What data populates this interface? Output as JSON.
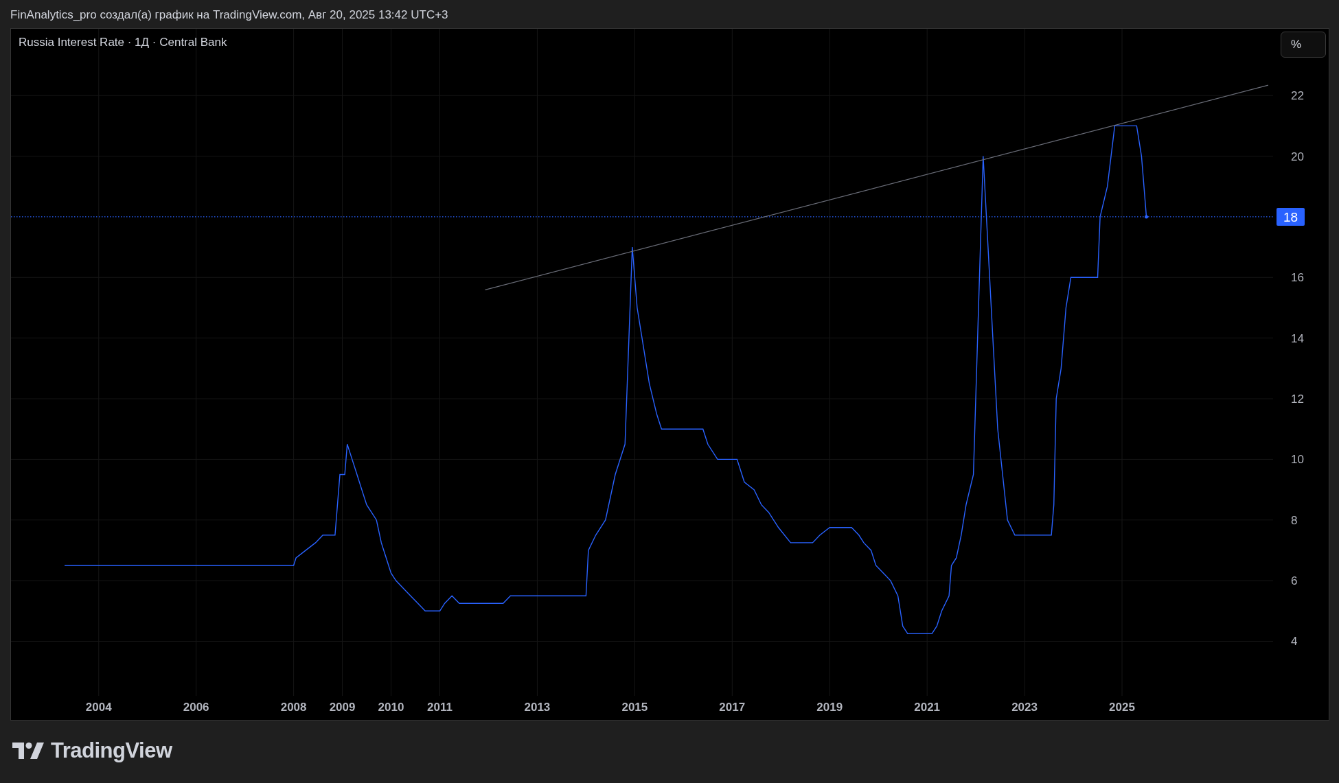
{
  "header": {
    "text": "FinAnalytics_pro создал(а) график на TradingView.com, Авг 20, 2025 13:42 UTC+3"
  },
  "chart": {
    "title": "Russia Interest Rate · 1Д · Central Bank",
    "scale_button": "%",
    "chart_data": {
      "type": "line",
      "grid": true,
      "xlim": [
        2002.2,
        2028.1
      ],
      "ylim": [
        2.2,
        24.2
      ],
      "xticks": [
        2004,
        2006,
        2008,
        2009,
        2010,
        2011,
        2013,
        2015,
        2017,
        2019,
        2021,
        2023,
        2025
      ],
      "yticks": [
        4,
        6,
        8,
        10,
        12,
        14,
        16,
        20,
        22
      ],
      "x": [
        2003.3,
        2008.0,
        2008.05,
        2008.25,
        2008.45,
        2008.6,
        2008.85,
        2008.95,
        2009.05,
        2009.1,
        2009.2,
        2009.3,
        2009.4,
        2009.5,
        2009.6,
        2009.7,
        2009.8,
        2009.9,
        2010.0,
        2010.1,
        2010.25,
        2010.4,
        2010.55,
        2010.7,
        2011.0,
        2011.1,
        2011.25,
        2011.4,
        2011.93,
        2012.3,
        2012.45,
        2014.0,
        2014.05,
        2014.2,
        2014.4,
        2014.6,
        2014.8,
        2014.95,
        2015.05,
        2015.15,
        2015.3,
        2015.45,
        2015.55,
        2016.4,
        2016.5,
        2016.7,
        2017.1,
        2017.25,
        2017.45,
        2017.6,
        2017.75,
        2017.95,
        2018.2,
        2018.65,
        2018.8,
        2019.0,
        2019.45,
        2019.6,
        2019.7,
        2019.85,
        2019.95,
        2020.1,
        2020.25,
        2020.4,
        2020.5,
        2020.6,
        2021.1,
        2021.2,
        2021.3,
        2021.45,
        2021.5,
        2021.6,
        2021.7,
        2021.8,
        2021.95,
        2022.15,
        2022.25,
        2022.35,
        2022.45,
        2022.55,
        2022.65,
        2022.8,
        2023.55,
        2023.6,
        2023.65,
        2023.75,
        2023.85,
        2023.95,
        2024.5,
        2024.55,
        2024.7,
        2024.85,
        2025.3,
        2025.4,
        2025.5,
        2028.0
      ],
      "series": [
        {
          "color": "#2962ff",
          "values": [
            6.5,
            6.5,
            6.75,
            7,
            7.25,
            7.5,
            7.5,
            9.5,
            9.5,
            10.5,
            10,
            9.5,
            9,
            8.5,
            8.25,
            8,
            7.25,
            6.75,
            6.25,
            6,
            5.75,
            5.5,
            5.25,
            5,
            5,
            5.25,
            5.5,
            5.25,
            5.25,
            5.25,
            5.5,
            5.5,
            7,
            7.5,
            8,
            9.5,
            10.5,
            17,
            15,
            14,
            12.5,
            11.5,
            11,
            11,
            10.5,
            10,
            10,
            9.25,
            9,
            8.5,
            8.25,
            7.75,
            7.25,
            7.25,
            7.5,
            7.75,
            7.75,
            7.5,
            7.25,
            7,
            6.5,
            6.25,
            6,
            5.5,
            4.5,
            4.25,
            4.25,
            4.5,
            5,
            5.5,
            6.5,
            6.75,
            7.5,
            8.5,
            9.5,
            20,
            17,
            14,
            11,
            9.5,
            8,
            7.5,
            7.5,
            8.5,
            12,
            13,
            15,
            16,
            16,
            18,
            19,
            21,
            21,
            20,
            18,
            null
          ]
        },
        {
          "color": "#6a6d78",
          "values": [
            null,
            null,
            null,
            null,
            null,
            null,
            null,
            null,
            null,
            null,
            null,
            null,
            null,
            null,
            null,
            null,
            null,
            null,
            null,
            null,
            null,
            null,
            null,
            null,
            null,
            null,
            null,
            null,
            15.59,
            null,
            null,
            null,
            null,
            null,
            null,
            null,
            null,
            null,
            null,
            null,
            null,
            null,
            null,
            null,
            null,
            null,
            null,
            null,
            null,
            null,
            null,
            null,
            null,
            null,
            null,
            null,
            null,
            null,
            null,
            null,
            null,
            null,
            null,
            null,
            null,
            null,
            null,
            null,
            null,
            null,
            null,
            null,
            null,
            null,
            null,
            null,
            null,
            null,
            null,
            null,
            null,
            null,
            null,
            null,
            null,
            null,
            null,
            null,
            null,
            null,
            null,
            null,
            null,
            null,
            null,
            22.34
          ]
        }
      ],
      "ref_lines": [
        {
          "axis": "y",
          "value": 18,
          "label": "18",
          "color": "#2962ff"
        }
      ]
    }
  },
  "footer": {
    "logo_text": "TradingView"
  }
}
